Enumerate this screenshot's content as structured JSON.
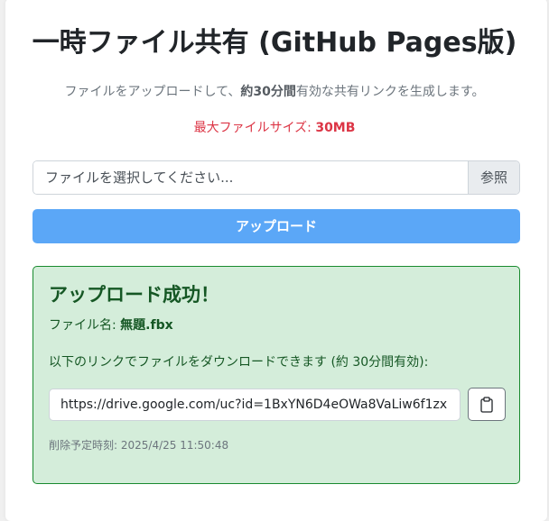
{
  "page": {
    "title": "一時ファイル共有 (GitHub Pages版)",
    "lead_prefix": "ファイルをアップロードして、",
    "lead_bold": "約30分間",
    "lead_suffix": "有効な共有リンクを生成します。",
    "limit_label": "最大ファイルサイズ: ",
    "limit_value": "30MB"
  },
  "file_input": {
    "placeholder": "ファイルを選択してください...",
    "browse_label": "参照"
  },
  "upload_button": {
    "label": "アップロード",
    "color": "#5ba7f7"
  },
  "result": {
    "heading": "アップロード成功！",
    "filename_label": "ファイル名: ",
    "filename_value": "無題.fbx",
    "link_description": "以下のリンクでファイルをダウンロードできます (約 30分間有効):",
    "link_value": "https://drive.google.com/uc?id=1BxYN6D4eOWa8VaLiw6f1zx",
    "copy_icon": "clipboard-icon",
    "deadline": "削除予定時刻: 2025/4/25 11:50:48",
    "success_bg": "#d4edda",
    "success_border": "#198a2e"
  }
}
